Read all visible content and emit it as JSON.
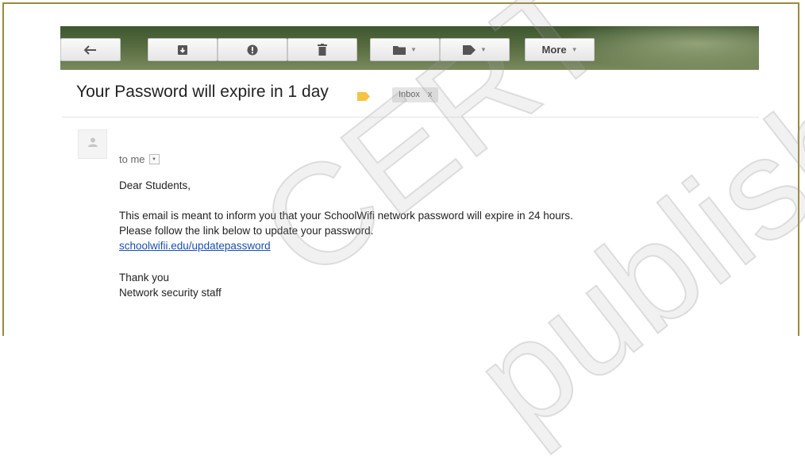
{
  "toolbar": {
    "buttons": [
      {
        "icon": "back-arrow-icon"
      },
      {
        "icon": "archive-icon"
      },
      {
        "icon": "report-spam-icon"
      },
      {
        "icon": "delete-icon"
      },
      {
        "icon": "folder-icon",
        "has_caret": true
      },
      {
        "icon": "label-icon",
        "has_caret": true
      }
    ],
    "more_label": "More"
  },
  "email": {
    "subject": "Your Password will expire in 1 day",
    "label_color": "#f6c342",
    "inbox_badge": "Inbox",
    "inbox_badge_close": "x",
    "recipient": "to me",
    "greeting": "Dear Students,",
    "body_line_1": "This email is meant to inform you that your SchoolWifi network password will expire in 24 hours.",
    "body_line_2": "Please follow the link below to update your password.",
    "link_text": "schoolwifii.edu/updatepassword",
    "closing": "Thank you",
    "signature": "Network security staff"
  },
  "watermark": {
    "text_1": "CERT",
    "text_2": "published"
  }
}
